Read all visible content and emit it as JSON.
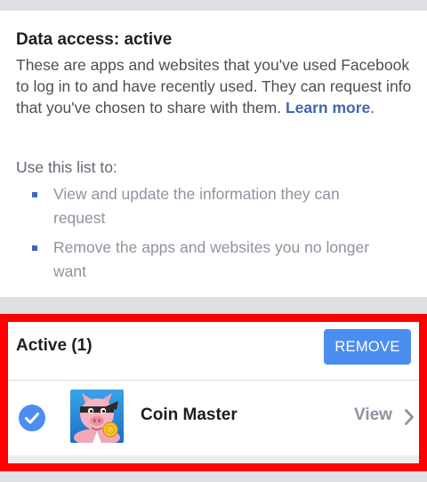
{
  "data_access": {
    "title": "Data access: active",
    "description": "These are apps and websites that you've used Facebook to log in to and have recently used. They can request info that you've chosen to share with them.",
    "learn_more": "Learn more",
    "period": ".",
    "use_heading": "Use this list to:",
    "bullets": [
      {
        "text": "View and update the information they can request"
      },
      {
        "text": "Remove the apps and websites you no longer want"
      }
    ]
  },
  "active_section": {
    "title": "Active (1)",
    "remove_label": "REMOVE",
    "apps": [
      {
        "name": "Coin Master",
        "icon": "coin-master-pig-icon",
        "selected": true,
        "view_label": "View"
      }
    ]
  },
  "colors": {
    "link": "#4267b2",
    "button": "#4b8ef0",
    "highlight_frame": "#ff0000",
    "page_background": "#dfe0e4"
  }
}
